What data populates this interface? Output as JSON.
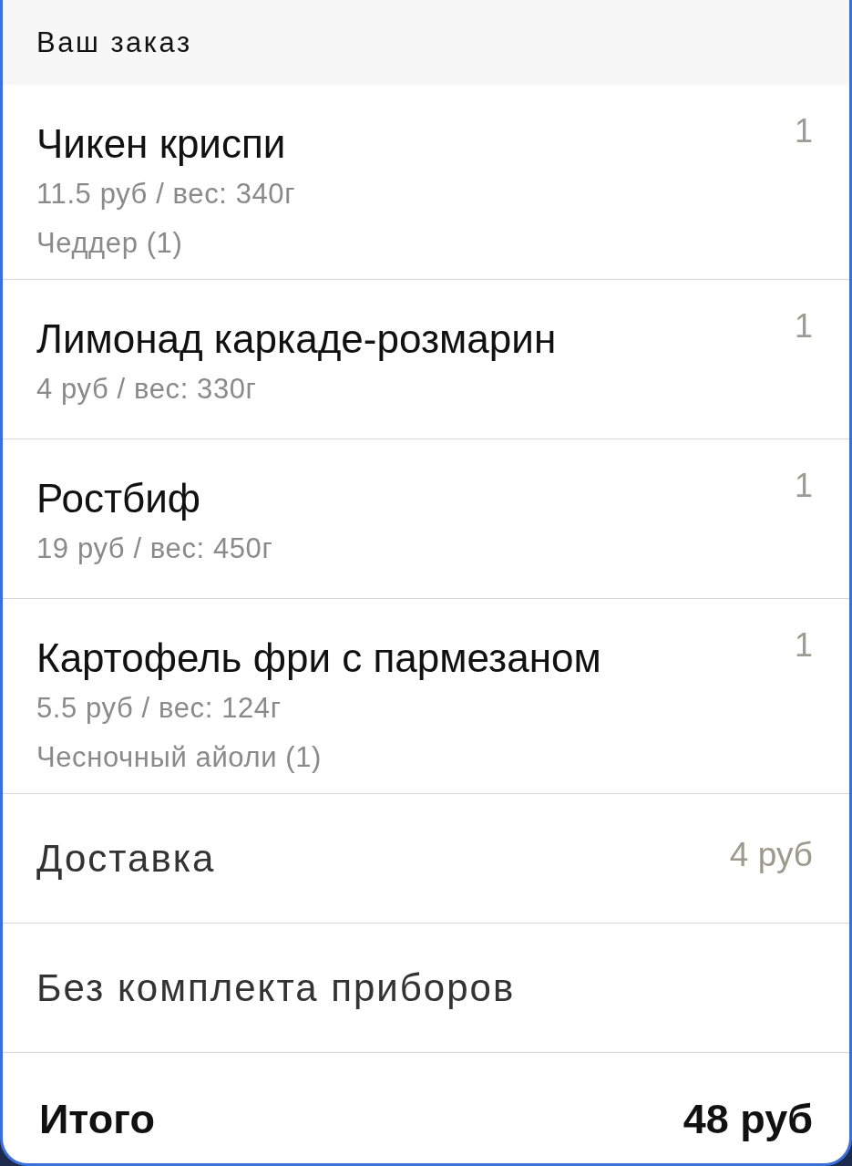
{
  "header": {
    "title": "Ваш заказ"
  },
  "items": [
    {
      "name": "Чикен криспи",
      "details": "11.5 руб / вес: 340г",
      "modifiers": [
        "Чеддер (1)"
      ],
      "quantity": "1"
    },
    {
      "name": "Лимонад каркаде-розмарин",
      "details": "4 руб / вес: 330г",
      "quantity": "1"
    },
    {
      "name": "Ростбиф",
      "details": "19 руб / вес: 450г",
      "quantity": "1"
    },
    {
      "name": "Картофель фри с пармезаном",
      "details": "5.5 руб / вес: 124г",
      "modifiers": [
        "Чесночный айоли (1)"
      ],
      "quantity": "1"
    }
  ],
  "summary_rows": [
    {
      "label": "Доставка",
      "value": "4 руб"
    },
    {
      "label": "Без комплекта приборов"
    }
  ],
  "total": {
    "label": "Итого",
    "value": "48 руб"
  }
}
